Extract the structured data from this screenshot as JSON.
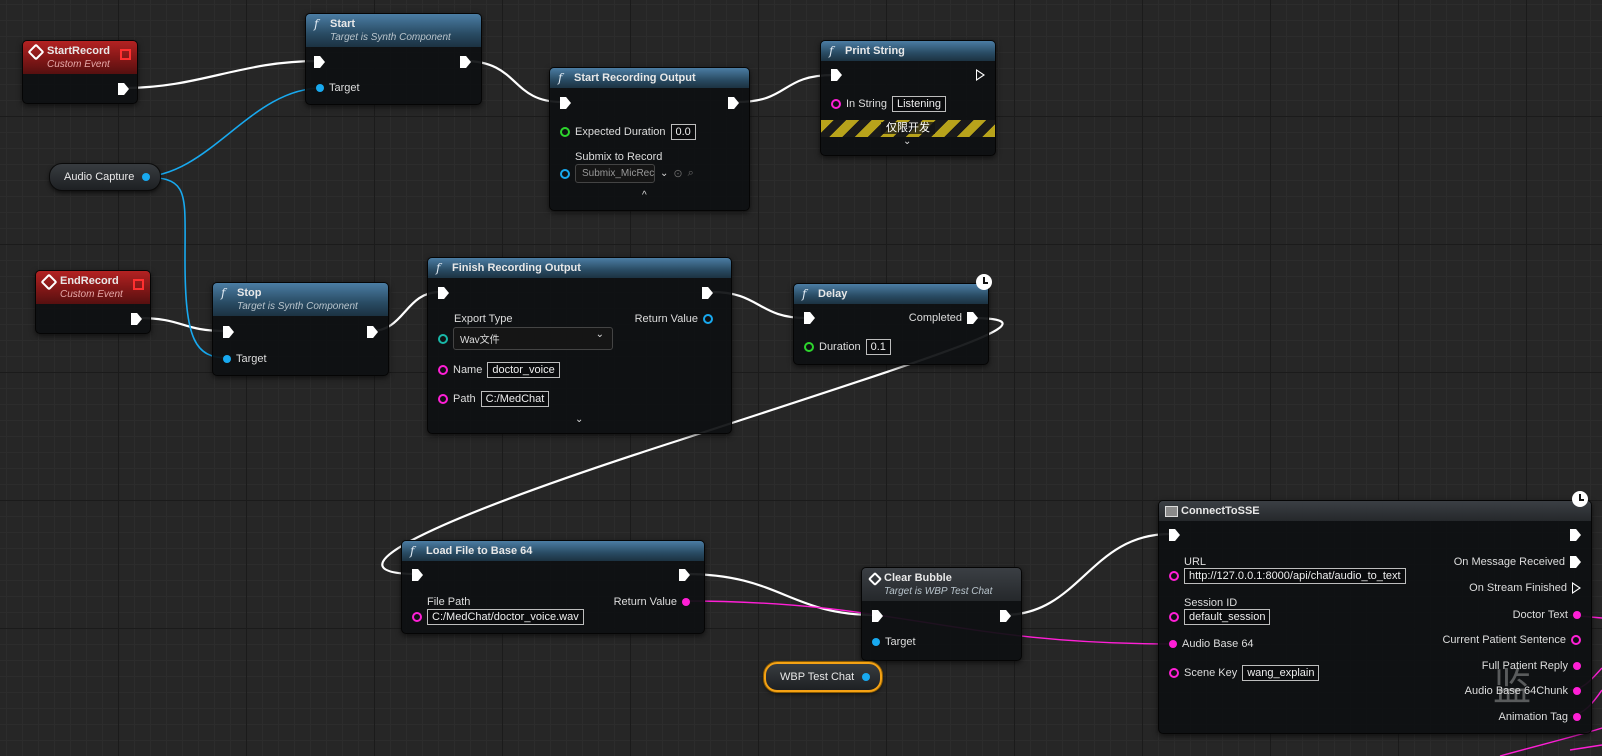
{
  "nodes": {
    "start_record": {
      "title": "StartRecord",
      "subtitle": "Custom Event"
    },
    "start": {
      "title": "Start",
      "subtitle": "Target is Synth Component",
      "target_label": "Target"
    },
    "start_recording_output": {
      "title": "Start Recording Output",
      "expected_duration_label": "Expected Duration",
      "expected_duration_value": "0.0",
      "submix_label": "Submix to Record",
      "submix_value": "Submix_MicRec"
    },
    "print_string": {
      "title": "Print String",
      "in_string_label": "In String",
      "in_string_value": "Listening",
      "dev_only_label": "仅限开发"
    },
    "audio_capture": {
      "label": "Audio Capture"
    },
    "end_record": {
      "title": "EndRecord",
      "subtitle": "Custom Event"
    },
    "stop": {
      "title": "Stop",
      "subtitle": "Target is Synth Component",
      "target_label": "Target"
    },
    "finish_recording_output": {
      "title": "Finish Recording Output",
      "export_type_label": "Export Type",
      "export_type_value": "Wav文件",
      "return_value_label": "Return Value",
      "name_label": "Name",
      "name_value": "doctor_voice",
      "path_label": "Path",
      "path_value": "C:/MedChat"
    },
    "delay": {
      "title": "Delay",
      "completed_label": "Completed",
      "duration_label": "Duration",
      "duration_value": "0.1"
    },
    "load_file": {
      "title": "Load File to Base 64",
      "file_path_label": "File Path",
      "file_path_value": "C:/MedChat/doctor_voice.wav",
      "return_value_label": "Return Value"
    },
    "clear_bubble": {
      "title": "Clear Bubble",
      "subtitle": "Target is WBP Test Chat",
      "target_label": "Target"
    },
    "wbp_test_chat": {
      "label": "WBP Test Chat"
    },
    "connect_to_sse": {
      "title": "ConnectToSSE",
      "url_label": "URL",
      "url_value": "http://127.0.0.1:8000/api/chat/audio_to_text",
      "session_id_label": "Session ID",
      "session_id_value": "default_session",
      "audio_base64_label": "Audio Base 64",
      "scene_key_label": "Scene Key",
      "scene_key_value": "wang_explain",
      "outputs": [
        "On Message Received",
        "On Stream Finished",
        "Doctor Text",
        "Current Patient Sentence",
        "Full Patient Reply",
        "Audio Base 64Chunk",
        "Animation Tag"
      ]
    }
  },
  "corner_watermark": "监",
  "colors": {
    "exec_wire": "#ffffff",
    "object_pin": "#18a9ef",
    "string_pin": "#ff1fd6",
    "float_pin": "#2dd52d",
    "event_header": "#8b1a1a",
    "function_header": "#3a6c90",
    "selection_outline": "#f5a214"
  }
}
